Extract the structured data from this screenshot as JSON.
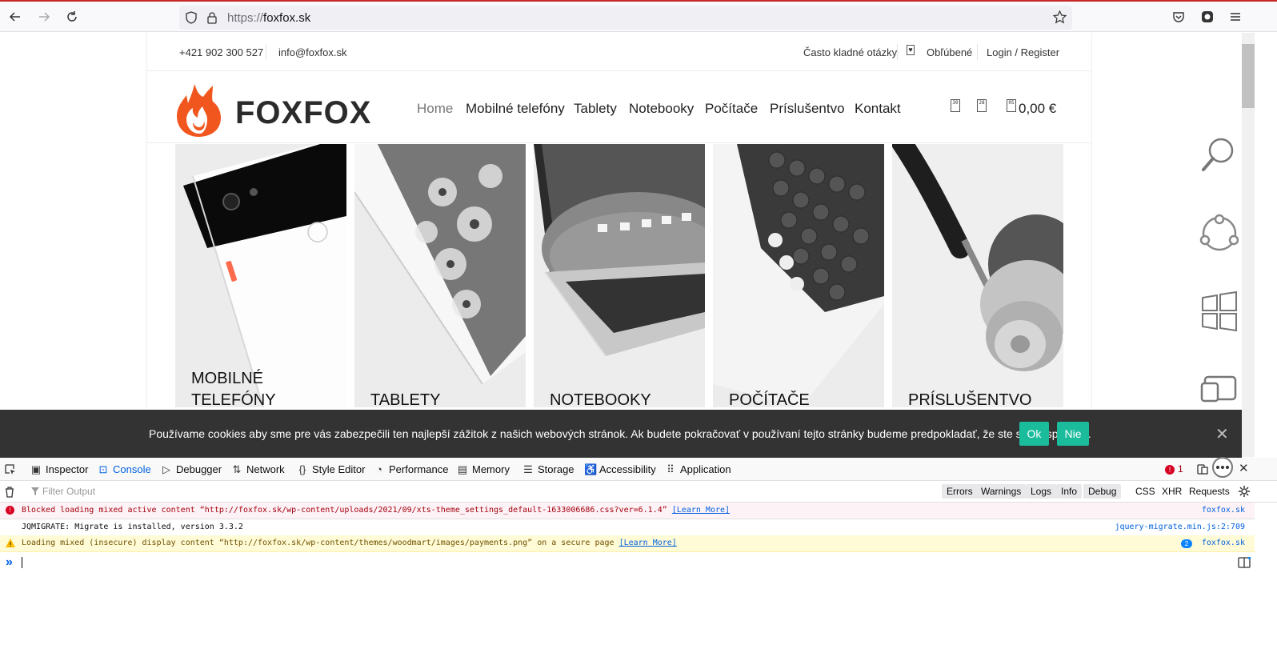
{
  "browser": {
    "url_scheme": "https://",
    "url_host": "foxfox.sk"
  },
  "site": {
    "topbar": {
      "phone": "+421 902 300 527",
      "email": "info@foxfox.sk",
      "faq": "Často kladné otázky",
      "favorites": "Obľúbené",
      "login": "Login / Register"
    },
    "logo": "FOXFOX",
    "nav": [
      "Home",
      "Mobilné telefóny",
      "Tablety",
      "Notebooky",
      "Počítače",
      "Príslušentvo",
      "Kontakt"
    ],
    "header_icons": [
      "30",
      "28",
      "05"
    ],
    "cart_total": "0,00 €",
    "categories": [
      {
        "line1": "MOBILNÉ",
        "line2": "TELEFÓNY"
      },
      {
        "line1": "TABLETY",
        "line2": ""
      },
      {
        "line1": "NOTEBOOKY",
        "line2": ""
      },
      {
        "line1": "POČÍTAČE",
        "line2": ""
      },
      {
        "line1": "PRÍSLUŠENTVO",
        "line2": ""
      }
    ]
  },
  "cookie": {
    "text": "Používame cookies aby sme pre vás zabezpečili ten najlepší zážitok z našich webových stránok. Ak budete pokračovať v používaní tejto stránky budeme predpokladať, že ste s ňou spokojní.",
    "ok": "Ok",
    "no": "Nie"
  },
  "devtools": {
    "tabs": [
      "Inspector",
      "Console",
      "Debugger",
      "Network",
      "Style Editor",
      "Performance",
      "Memory",
      "Storage",
      "Accessibility",
      "Application"
    ],
    "error_count": "1",
    "filter_placeholder": "Filter Output",
    "filters": [
      "Errors",
      "Warnings",
      "Logs",
      "Info",
      "Debug"
    ],
    "filters_plain": [
      "CSS",
      "XHR",
      "Requests"
    ],
    "messages": [
      {
        "text": "Blocked loading mixed active content “http://foxfox.sk/wp-content/uploads/2021/09/xts-theme_settings_default-1633006686.css?ver=6.1.4”",
        "link": "[Learn More]",
        "src": "foxfox.sk"
      },
      {
        "text": "JQMIGRATE: Migrate is installed, version 3.3.2",
        "link": "",
        "src": "jquery-migrate.min.js:2:709"
      },
      {
        "text": "Loading mixed (insecure) display content “http://foxfox.sk/wp-content/themes/woodmart/images/payments.png” on a secure page",
        "link": "[Learn More]",
        "src": "foxfox.sk",
        "count": "2"
      }
    ]
  },
  "colors": {
    "accent": "#1abc9c",
    "logo_orange": "#f0561d",
    "devtools_blue": "#0060df"
  }
}
